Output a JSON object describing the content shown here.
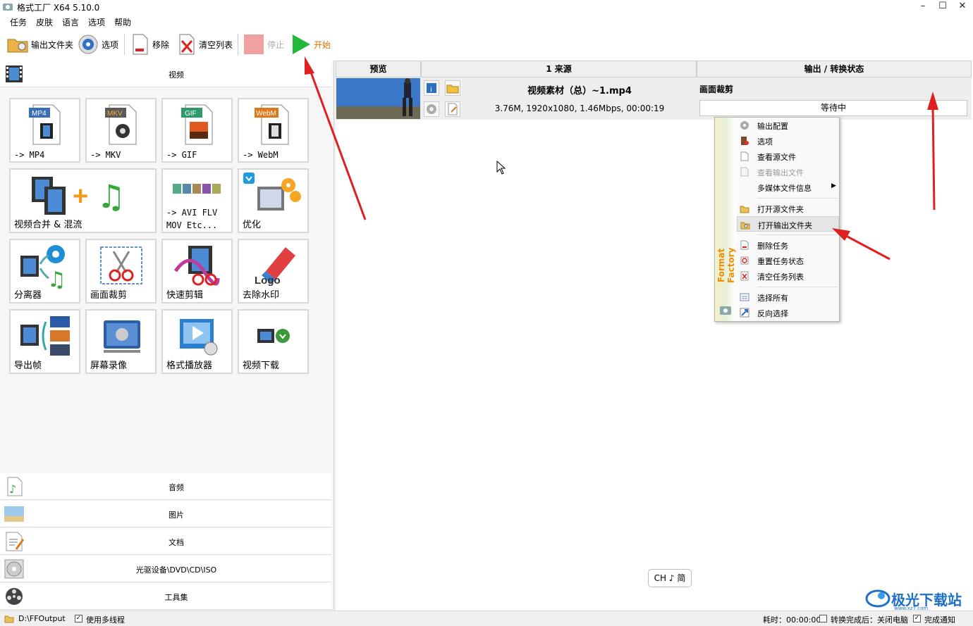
{
  "window": {
    "title": "格式工厂 X64 5.10.0",
    "minimize": "–",
    "maximize": "☐",
    "close": "✕"
  },
  "menu": [
    "任务",
    "皮肤",
    "语言",
    "选项",
    "帮助"
  ],
  "toolbar": {
    "output_folder": "输出文件夹",
    "options": "选项",
    "remove": "移除",
    "clear_list": "清空列表",
    "stop": "停止",
    "start": "开始"
  },
  "left": {
    "video_header": "视频",
    "tiles": [
      {
        "label": "-> MP4",
        "badge": "MP4",
        "badge_color": "#3a6fb7"
      },
      {
        "label": "-> MKV",
        "badge": "MKV",
        "badge_color": "#5a5a5a"
      },
      {
        "label": "-> GIF",
        "badge": "GIF",
        "badge_color": "#2c9a6a"
      },
      {
        "label": "-> WebM",
        "badge": "WebM",
        "badge_color": "#e0781a"
      },
      {
        "label": "视频合并 & 混流"
      },
      {
        "label1": "-> AVI FLV",
        "label2": "MOV Etc..."
      },
      {
        "label": "优化"
      },
      {
        "label": "分离器"
      },
      {
        "label": "画面裁剪"
      },
      {
        "label": "快速剪辑"
      },
      {
        "label": "去除水印",
        "logo_text": "Logo"
      },
      {
        "label": "导出帧"
      },
      {
        "label": "屏幕录像"
      },
      {
        "label": "格式播放器"
      },
      {
        "label": "视频下载"
      }
    ],
    "categories": [
      "音频",
      "图片",
      "文档",
      "光驱设备\\DVD\\CD\\ISO",
      "工具集"
    ]
  },
  "table": {
    "headers": [
      "预览",
      "1 来源",
      "输出 / 转换状态"
    ],
    "task": {
      "name": "视频素材（总）~1.mp4",
      "info": "3.76M, 1920x1080, 1.46Mbps, 00:00:19",
      "output_type": "画面裁剪",
      "status": "等待中"
    }
  },
  "context_menu": {
    "side_text": "Format Factory",
    "items": [
      {
        "label": "输出配置"
      },
      {
        "label": "选项"
      },
      {
        "label": "查看源文件"
      },
      {
        "label": "查看输出文件"
      },
      {
        "label": "多媒体文件信息"
      },
      {
        "label": "打开源文件夹"
      },
      {
        "label": "打开输出文件夹"
      },
      {
        "label": "删除任务"
      },
      {
        "label": "重置任务状态"
      },
      {
        "label": "清空任务列表"
      },
      {
        "label": "选择所有"
      },
      {
        "label": "反向选择"
      }
    ],
    "submenu_arrow": "▶"
  },
  "ime": {
    "label": "CH ♪ 简"
  },
  "statusbar": {
    "output_path": "D:\\FFOutput",
    "multithread": "使用多线程",
    "elapsed": "耗时：00:00:00",
    "after_done": "转换完成后：关闭电脑",
    "notify": "完成通知"
  },
  "watermark": {
    "text": "极光下载站",
    "url": "www.xz7.com"
  },
  "colors": {
    "annotation_arrow": "#e02020",
    "start_green": "#22b83a",
    "stop_pink": "#f0a0a0"
  }
}
